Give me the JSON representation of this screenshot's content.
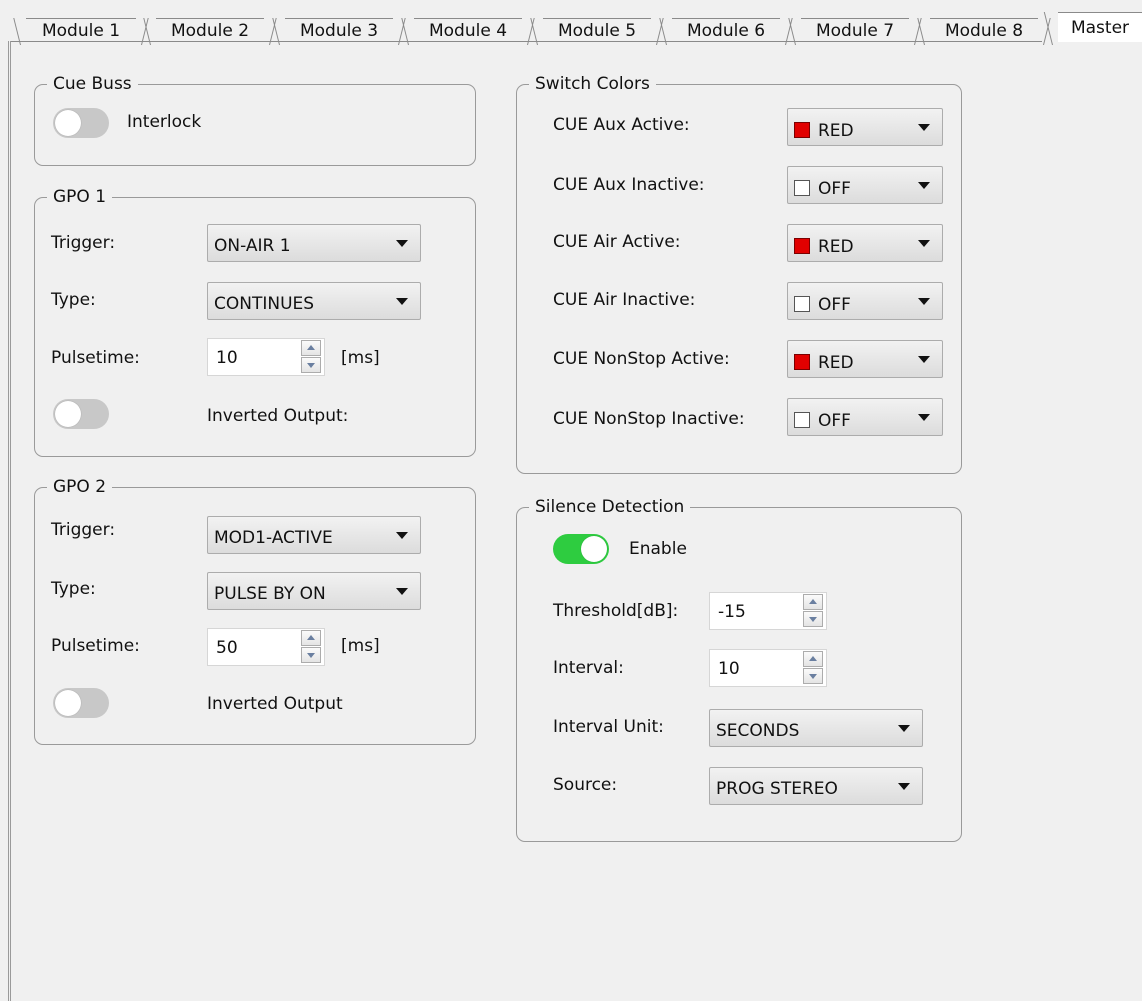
{
  "tabs": [
    {
      "label": "Module 1"
    },
    {
      "label": "Module 2"
    },
    {
      "label": "Module 3"
    },
    {
      "label": "Module 4"
    },
    {
      "label": "Module 5"
    },
    {
      "label": "Module 6"
    },
    {
      "label": "Module 7"
    },
    {
      "label": "Module 8"
    },
    {
      "label": "Master",
      "active": true
    }
  ],
  "cue_buss": {
    "title": "Cue Buss",
    "interlock_label": "Interlock",
    "interlock_on": false
  },
  "gpo1": {
    "title": "GPO 1",
    "trigger_label": "Trigger:",
    "trigger_value": "ON-AIR 1",
    "type_label": "Type:",
    "type_value": "CONTINUES",
    "pulsetime_label": "Pulsetime:",
    "pulsetime_value": "10",
    "pulsetime_unit": "[ms]",
    "inverted_label": "Inverted Output:",
    "inverted_on": false
  },
  "gpo2": {
    "title": "GPO 2",
    "trigger_label": "Trigger:",
    "trigger_value": "MOD1-ACTIVE",
    "type_label": "Type:",
    "type_value": "PULSE BY ON",
    "pulsetime_label": "Pulsetime:",
    "pulsetime_value": "50",
    "pulsetime_unit": "[ms]",
    "inverted_label": "Inverted Output",
    "inverted_on": false
  },
  "switch_colors": {
    "title": "Switch Colors",
    "rows": [
      {
        "label": "CUE Aux Active:",
        "value": "RED",
        "color": "#e10000"
      },
      {
        "label": "CUE Aux Inactive:",
        "value": "OFF",
        "color": "#ffffff"
      },
      {
        "label": "CUE Air Active:",
        "value": "RED",
        "color": "#e10000"
      },
      {
        "label": "CUE Air Inactive:",
        "value": "OFF",
        "color": "#ffffff"
      },
      {
        "label": "CUE NonStop Active:",
        "value": "RED",
        "color": "#e10000"
      },
      {
        "label": "CUE NonStop Inactive:",
        "value": "OFF",
        "color": "#ffffff"
      }
    ]
  },
  "silence_detection": {
    "title": "Silence Detection",
    "enable_label": "Enable",
    "enable_on": true,
    "threshold_label": "Threshold[dB]:",
    "threshold_value": "-15",
    "interval_label": "Interval:",
    "interval_value": "10",
    "interval_unit_label": "Interval Unit:",
    "interval_unit_value": "SECONDS",
    "source_label": "Source:",
    "source_value": "PROG STEREO"
  },
  "colors": {
    "toggle_on": "#2ecc40",
    "toggle_off": "#c8c8c8",
    "swatch_red": "#e10000"
  }
}
